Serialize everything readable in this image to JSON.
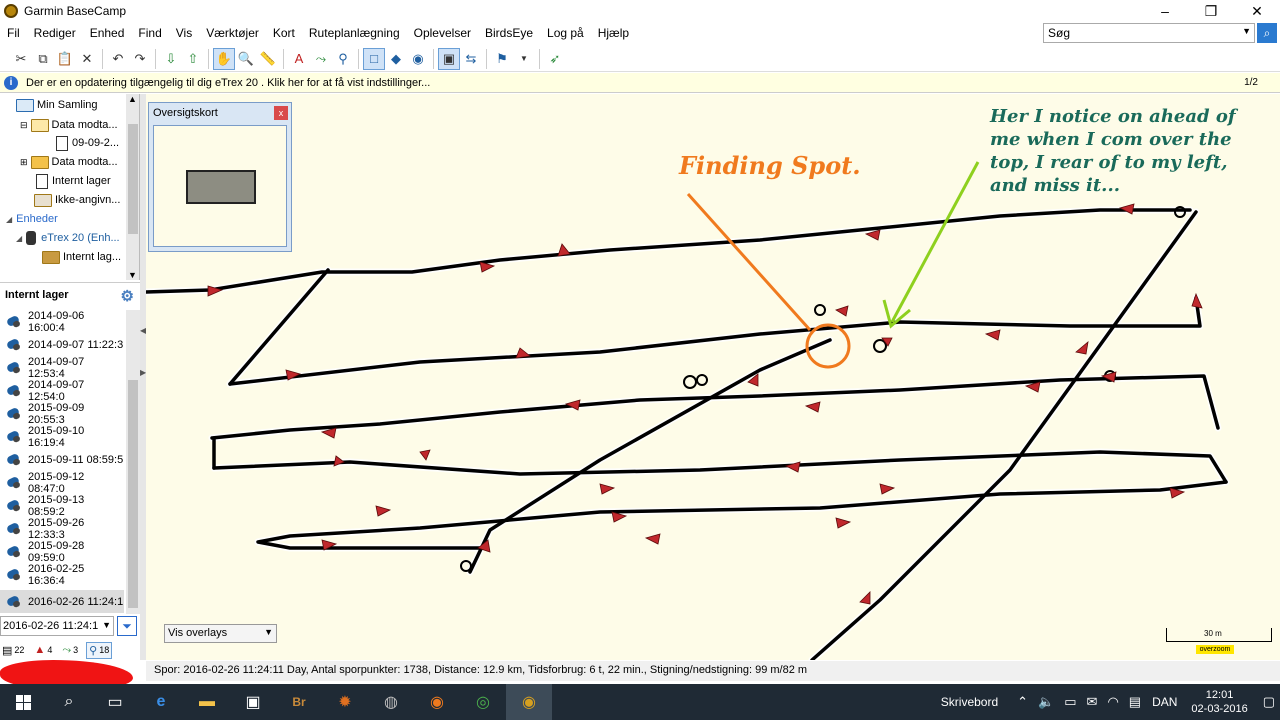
{
  "window": {
    "title": "Garmin BaseCamp",
    "min": "–",
    "max": "❐",
    "close": "✕"
  },
  "menu": [
    "Fil",
    "Rediger",
    "Enhed",
    "Find",
    "Vis",
    "Værktøjer",
    "Kort",
    "Ruteplanlægning",
    "Oplevelser",
    "BirdsEye",
    "Log på",
    "Hjælp"
  ],
  "search": {
    "placeholder": "Søg"
  },
  "info": {
    "text": "Der er en opdatering tilgængelig til dig eTrex 20 . Klik her for at få vist indstillinger...",
    "page": "1/2"
  },
  "tree": {
    "items": [
      {
        "label": "Min Samling"
      },
      {
        "label": "Data modta..."
      },
      {
        "label": "09-09-2..."
      },
      {
        "label": "Data modta..."
      },
      {
        "label": "Internt lager"
      },
      {
        "label": "Ikke-angivn..."
      }
    ],
    "devices_header": "Enheder",
    "device": "eTrex 20 (Enh...",
    "device_storage": "Internt lag..."
  },
  "panel": {
    "title": "Internt lager"
  },
  "tracks": [
    "2014-09-06 16:00:4",
    "2014-09-07 11:22:3",
    "2014-09-07 12:53:4",
    "2014-09-07 12:54:0",
    "2015-09-09 20:55:3",
    "2015-09-10 16:19:4",
    "2015-09-11 08:59:5",
    "2015-09-12 08:47:0",
    "2015-09-13 08:59:2",
    "2015-09-26 12:33:3",
    "2015-09-28 09:59:0",
    "2016-02-25 16:36:4",
    "2016-02-26 11:24:1"
  ],
  "selected_track": "2016-02-26 11:24:1",
  "counts": {
    "waypoints": "22",
    "routes": "4",
    "tracks_alt": "3",
    "tracks": "18"
  },
  "overview": {
    "title": "Oversigtskort",
    "close": "x"
  },
  "overlay_select": "Vis overlays",
  "scale": {
    "label": "30 m",
    "overzoom": "overzoom"
  },
  "annotations": {
    "orange": "Finding Spot.",
    "green": "Her I notice on ahead of me when I com over the top, I rear of to my left, and miss it..."
  },
  "status": "Spor: 2016-02-26 11:24:11 Day, Antal sporpunkter: 1738, Distance: 12.9 km, Tidsforbrug: 6 t, 22 min., Stigning/nedstigning: 99 m/82 m",
  "taskbar": {
    "desktop": "Skrivebord",
    "lang": "DAN",
    "time": "12:01",
    "date": "02-03-2016"
  }
}
